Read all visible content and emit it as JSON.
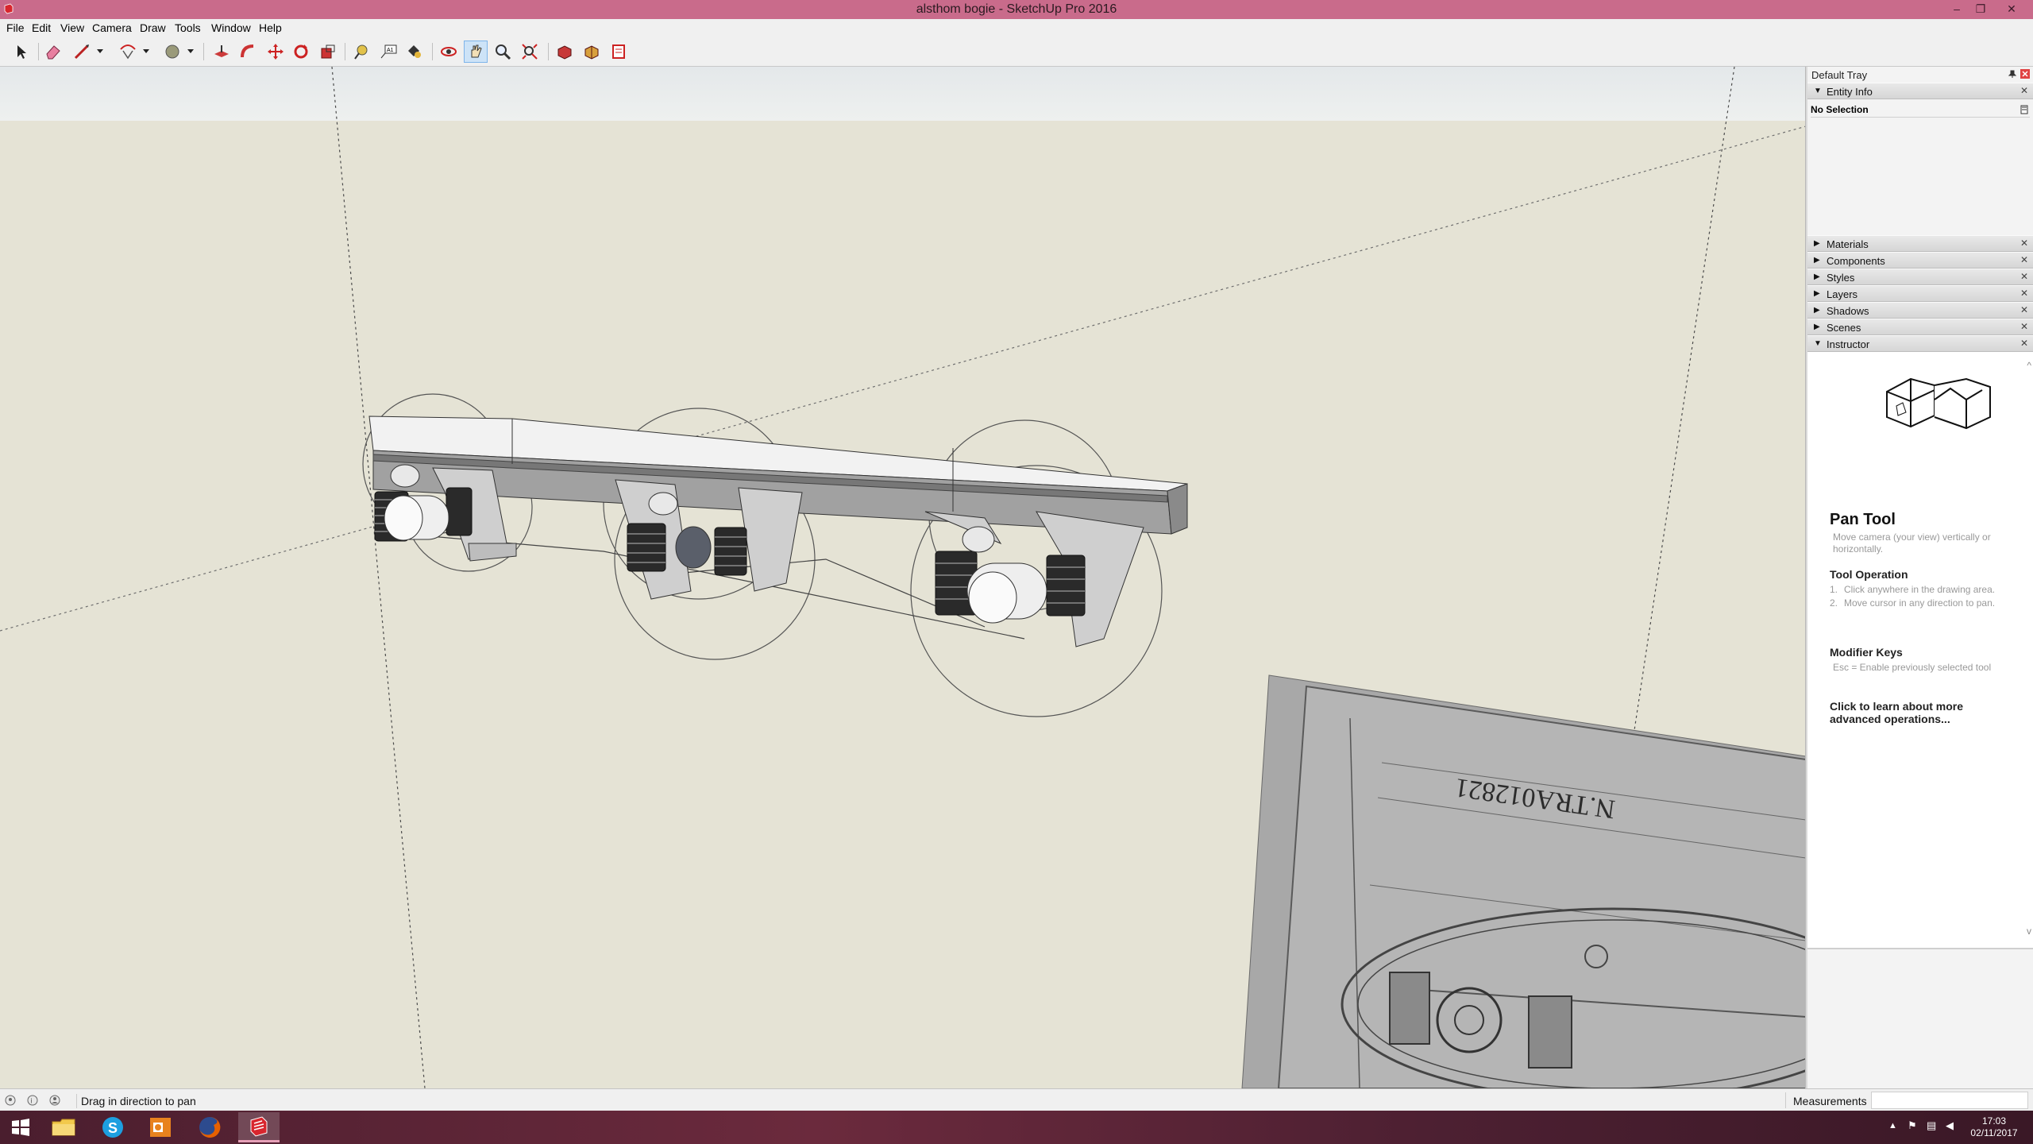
{
  "window": {
    "title": "alsthom bogie - SketchUp Pro 2016",
    "minimize": "–",
    "maximize": "❐",
    "close": "✕"
  },
  "menu": [
    "File",
    "Edit",
    "View",
    "Camera",
    "Draw",
    "Tools",
    "Window",
    "Help"
  ],
  "toolbar": {
    "active_tool": "pan",
    "tools": [
      "select-icon",
      "eraser-icon",
      "line-icon",
      "arc-icon",
      "circle-icon",
      "push-pull-icon",
      "follow-me-icon",
      "move-icon",
      "rotate-icon",
      "scale-icon",
      "tape-measure-icon",
      "text-icon",
      "paint-bucket-icon",
      "orbit-icon",
      "pan-icon",
      "zoom-icon",
      "zoom-extents-icon",
      "3d-warehouse-icon",
      "extension-warehouse-icon",
      "layout-icon"
    ]
  },
  "tray": {
    "title": "Default Tray",
    "entity_info": {
      "label": "Entity Info",
      "selection": "No Selection"
    },
    "panels": [
      "Materials",
      "Components",
      "Styles",
      "Layers",
      "Shadows",
      "Scenes"
    ],
    "instructor": {
      "label": "Instructor",
      "tool_name": "Pan Tool",
      "tool_desc": "Move camera (your view) vertically or horizontally.",
      "operation_title": "Tool Operation",
      "steps": [
        "Click anywhere in the drawing area.",
        "Move cursor in any direction to pan."
      ],
      "modifier_title": "Modifier Keys",
      "modifier_text": "Esc = Enable previously selected tool",
      "learn_more": "Click to learn about more advanced operations..."
    }
  },
  "drawing": {
    "label": "N.TRA012821"
  },
  "status": {
    "hint": "Drag in direction to pan",
    "measurements_label": "Measurements",
    "measurements_value": ""
  },
  "taskbar": {
    "apps": [
      "windows-start-icon",
      "file-explorer-icon",
      "skype-icon",
      "outlook-icon",
      "firefox-icon",
      "sketchup-icon"
    ],
    "time": "17:03",
    "date": "02/11/2017"
  }
}
